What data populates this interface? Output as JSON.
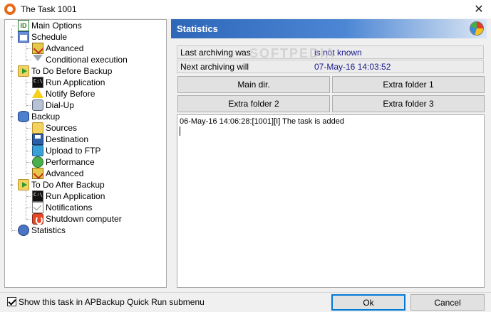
{
  "window": {
    "title": "The Task 1001",
    "close_glyph": "✕"
  },
  "tree": {
    "items": [
      {
        "label": "Main Options",
        "icon": "id-icon"
      },
      {
        "label": "Schedule",
        "icon": "calendar-icon"
      },
      {
        "label": "Advanced",
        "icon": "advanced-icon"
      },
      {
        "label": "Conditional execution",
        "icon": "funnel-icon"
      },
      {
        "label": "To Do Before Backup",
        "icon": "folder-run-icon"
      },
      {
        "label": "Run Application",
        "icon": "console-icon"
      },
      {
        "label": "Notify Before",
        "icon": "warning-icon"
      },
      {
        "label": "Dial-Up",
        "icon": "phone-icon"
      },
      {
        "label": "Backup",
        "icon": "database-icon"
      },
      {
        "label": "Sources",
        "icon": "folder-icon"
      },
      {
        "label": "Destination",
        "icon": "floppy-icon"
      },
      {
        "label": "Upload to FTP",
        "icon": "ftp-icon"
      },
      {
        "label": "Performance",
        "icon": "performance-icon"
      },
      {
        "label": "Advanced",
        "icon": "advanced-icon"
      },
      {
        "label": "To Do After Backup",
        "icon": "folder-run-icon"
      },
      {
        "label": "Run Application",
        "icon": "console-icon"
      },
      {
        "label": "Notifications",
        "icon": "envelope-icon"
      },
      {
        "label": "Shutdown computer",
        "icon": "power-icon"
      },
      {
        "label": "Statistics",
        "icon": "statistics-icon"
      }
    ],
    "expander_glyph": "−"
  },
  "panel": {
    "title": "Statistics",
    "icon": "pie-chart-icon"
  },
  "info": {
    "last_label": "Last archiving was",
    "last_value": "is not known",
    "next_label": "Next archiving will",
    "next_value": "07-May-16 14:03:52"
  },
  "watermark": "SOFTPEDIA",
  "folder_buttons": {
    "main": "Main dir.",
    "extra1": "Extra folder 1",
    "extra2": "Extra folder 2",
    "extra3": "Extra folder 3"
  },
  "log": {
    "lines": [
      "06-May-16 14:06:28:[1001][I] The task is added"
    ]
  },
  "footer": {
    "checkbox_label": "Show this task in APBackup Quick Run submenu",
    "checkbox_checked": true,
    "ok_label": "Ok",
    "cancel_label": "Cancel"
  },
  "colors": {
    "header_start": "#2e67b8",
    "header_end": "#dbe6f4",
    "value_text": "#1a1a8c"
  }
}
